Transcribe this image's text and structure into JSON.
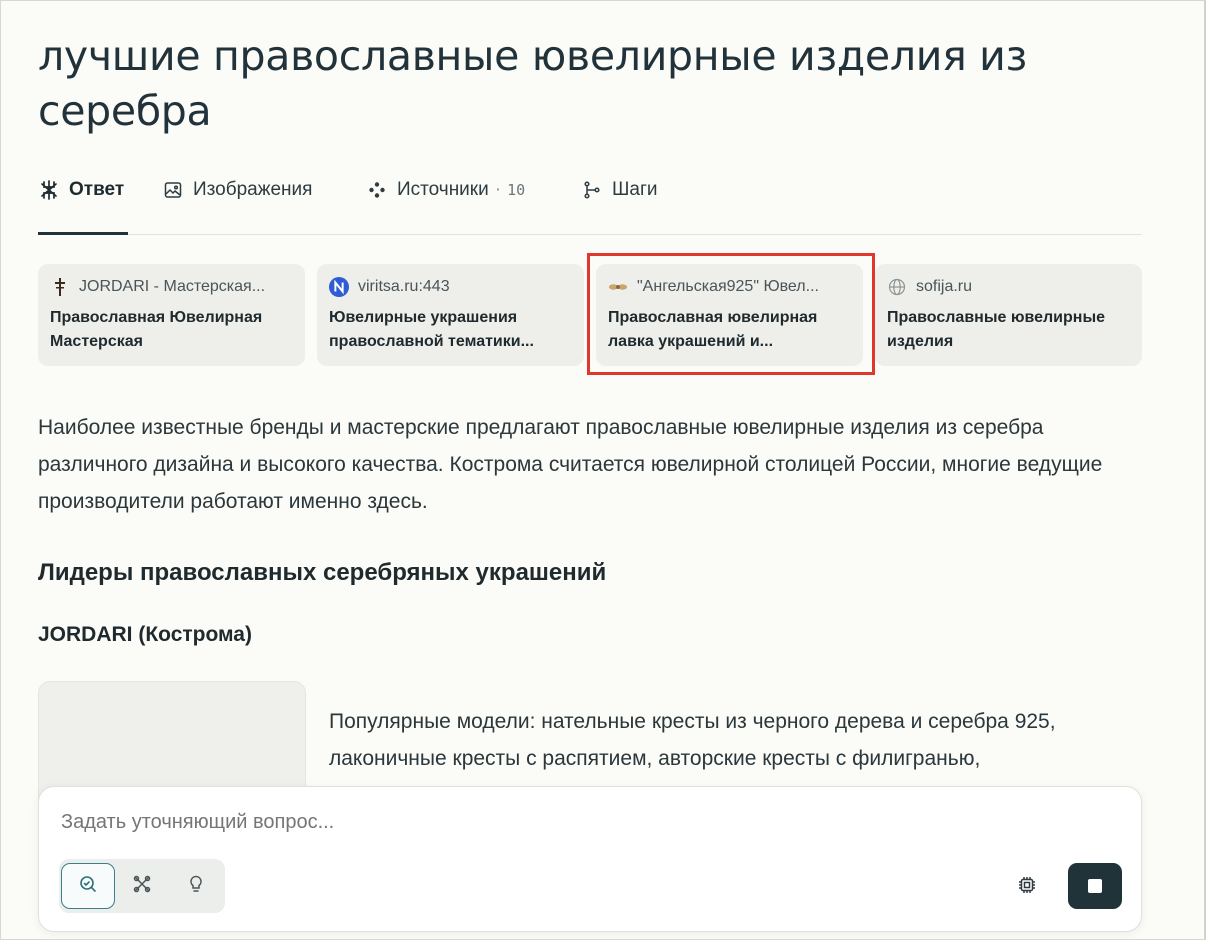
{
  "page": {
    "title": "лучшие православные ювелирные изделия из серебра"
  },
  "tabs": [
    {
      "label": "Ответ",
      "icon": "snowflake-icon",
      "active": true
    },
    {
      "label": "Изображения",
      "icon": "image-icon",
      "active": false
    },
    {
      "label": "Источники",
      "icon": "sources-icon",
      "count": "10",
      "active": false
    },
    {
      "label": "Шаги",
      "icon": "steps-icon",
      "active": false
    }
  ],
  "sources": [
    {
      "site": "JORDARI - Мастерская...",
      "title": "Православная Ювелирная Мастерская",
      "favicon": "cross-favicon"
    },
    {
      "site": "viritsa.ru:443",
      "title": "Ювелирные украшения православной тематики...",
      "favicon": "n-favicon",
      "favicon_color": "#2f5bd3"
    },
    {
      "site": "\"Ангельская925\" Ювел...",
      "title": "Православная ювелирная лавка украшений и...",
      "favicon": "wings-favicon",
      "highlighted": true
    },
    {
      "site": "sofija.ru",
      "title": "Православные ювелирные изделия",
      "favicon": "globe-favicon"
    }
  ],
  "answer": {
    "intro": "Наиболее известные бренды и мастерские предлагают православные ювелирные изделия из серебра различного дизайна и высокого качества. Кострома считается ювелирной столицей России, многие ведущие производители работают именно здесь.",
    "section_heading": "Лидеры православных серебряных украшений",
    "subheading": "JORDARI (Кострома)",
    "detail": "Популярные модели: нательные кресты из черного дерева и серебра 925, лаконичные кресты с распятием, авторские кресты с филигранью,"
  },
  "composer": {
    "placeholder": "Задать уточняющий вопрос...",
    "modes": [
      {
        "name": "search-mode",
        "icon": "search-icon",
        "active": true
      },
      {
        "name": "research-mode",
        "icon": "research-icon",
        "active": false
      },
      {
        "name": "labs-mode",
        "icon": "lightbulb-icon",
        "active": false
      }
    ],
    "model_icon": "chip-icon",
    "stop_icon": "stop-icon"
  },
  "colors": {
    "accent": "#3b7f8a",
    "highlight_border": "#e0362b",
    "stop_button": "#1f3338"
  }
}
